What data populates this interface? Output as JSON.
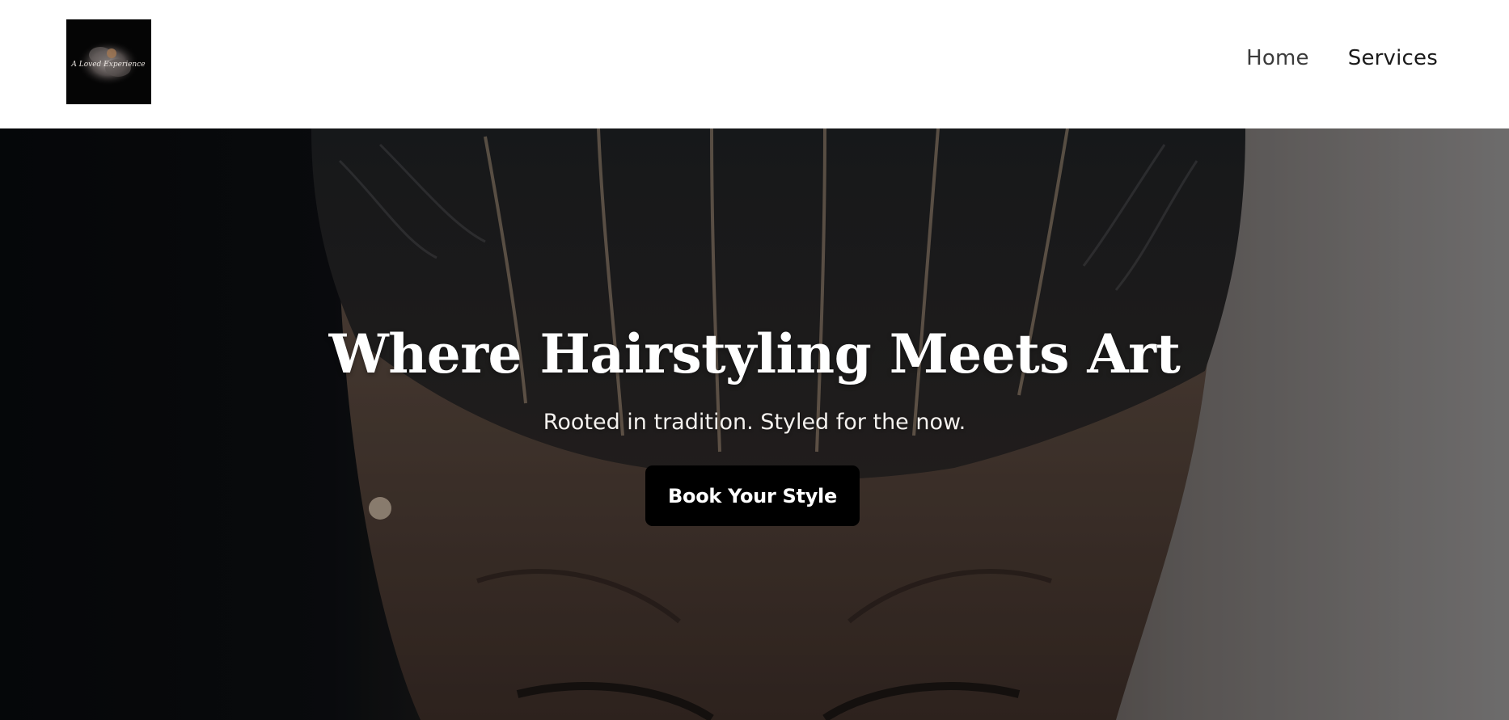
{
  "header": {
    "logo_text": "A Loved Experience",
    "nav": [
      {
        "label": "Home",
        "active": true
      },
      {
        "label": "Services",
        "active": false
      }
    ]
  },
  "hero": {
    "title": "Where Hairstyling Meets Art",
    "subtitle": "Rooted in tradition. Styled for the now.",
    "cta_label": "Book Your Style"
  },
  "colors": {
    "header_bg": "#ffffff",
    "nav_text": "#1b1b1b",
    "cta_bg": "#000000",
    "cta_text": "#ffffff",
    "hero_text": "#ffffff"
  }
}
